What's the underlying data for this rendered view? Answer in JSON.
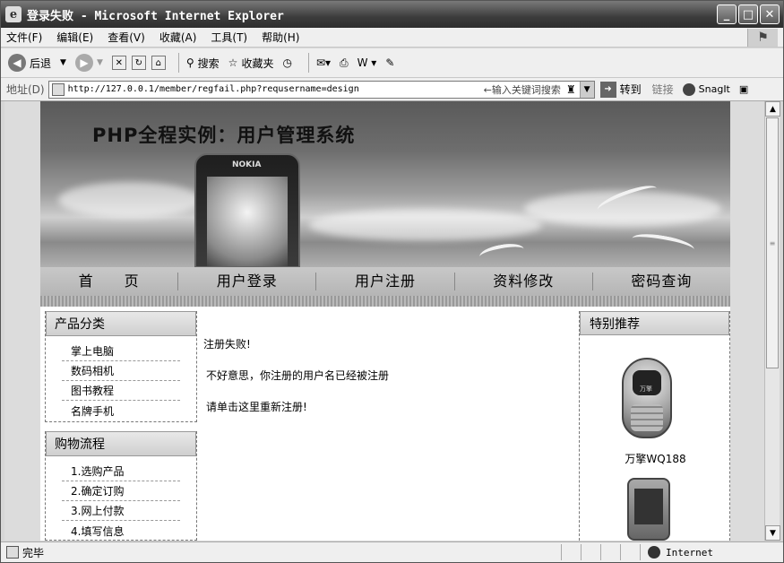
{
  "window": {
    "title": "登录失败 - Microsoft Internet Explorer"
  },
  "menu": [
    "文件(F)",
    "编辑(E)",
    "查看(V)",
    "收藏(A)",
    "工具(T)",
    "帮助(H)"
  ],
  "toolbar": {
    "back": "后退",
    "search": "搜索",
    "favorites": "收藏夹"
  },
  "address": {
    "label": "地址(D)",
    "url": "http://127.0.0.1/member/regfail.php?requsername=design",
    "search_hint": "←输入关键词搜索",
    "go": "转到",
    "links": "链接",
    "snagit": "SnagIt"
  },
  "banner": {
    "title": "PHP全程实例：用户管理系统",
    "phone_brand": "NOKIA"
  },
  "nav": [
    "首　　页",
    "用户登录",
    "用户注册",
    "资料修改",
    "密码查询"
  ],
  "sidebar": {
    "categories": {
      "title": "产品分类",
      "items": [
        "掌上电脑",
        "数码相机",
        "图书教程",
        "名牌手机"
      ]
    },
    "flow": {
      "title": "购物流程",
      "items": [
        "1.选购产品",
        "2.确定订购",
        "3.网上付款",
        "4.填写信息"
      ]
    }
  },
  "main": {
    "line1": "注册失败!",
    "line2": "不好意思，你注册的用户名已经被注册",
    "line3_prefix": "请单击",
    "line3_link": "这里",
    "line3_suffix": "重新注册!"
  },
  "featured": {
    "title": "特别推荐",
    "product1": "万擎WQ188",
    "phone1_brand": "万擎"
  },
  "status": {
    "text": "完毕",
    "zone": "Internet"
  }
}
